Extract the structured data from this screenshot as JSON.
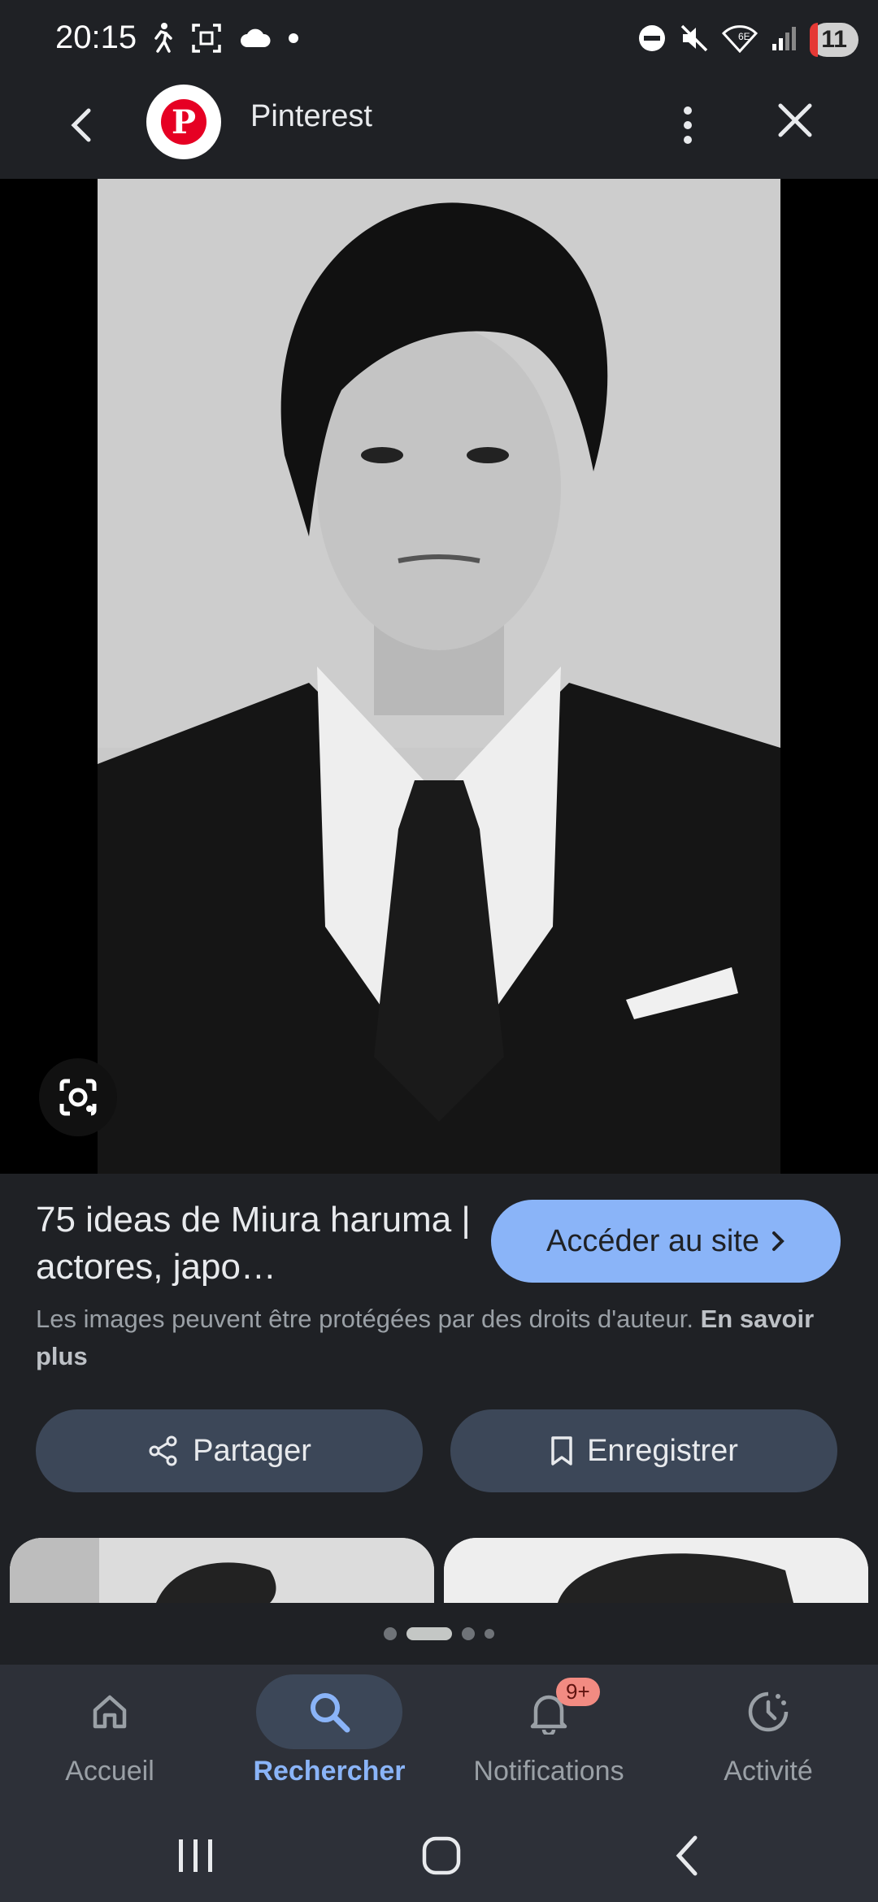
{
  "status_bar": {
    "time": "20:15",
    "battery": "11",
    "left_icons": [
      "walk-icon",
      "screenshot-icon",
      "cloud-icon",
      "dot-icon"
    ],
    "right_icons": [
      "do-not-disturb-icon",
      "mute-icon",
      "wifi-6e-icon",
      "signal-icon"
    ]
  },
  "app_bar": {
    "site_name": "Pinterest"
  },
  "result": {
    "title": "75 ideas de Miura haruma | actores, japo…",
    "visit_button": "Accéder au site",
    "copyright_text": "Les images peuvent être protégées par des droits d'auteur.",
    "learn_more": "En savoir plus"
  },
  "actions": {
    "share": "Partager",
    "save": "Enregistrer"
  },
  "bottom_nav": {
    "items": [
      {
        "label": "Accueil",
        "icon": "home-icon"
      },
      {
        "label": "Rechercher",
        "icon": "search-icon",
        "active": true
      },
      {
        "label": "Notifications",
        "icon": "bell-icon",
        "badge": "9+"
      },
      {
        "label": "Activité",
        "icon": "activity-icon"
      }
    ]
  },
  "colors": {
    "background": "#1f2125",
    "accent": "#8ab4f8",
    "pill_button": "#3c4758",
    "nav_background": "#2d3038"
  }
}
